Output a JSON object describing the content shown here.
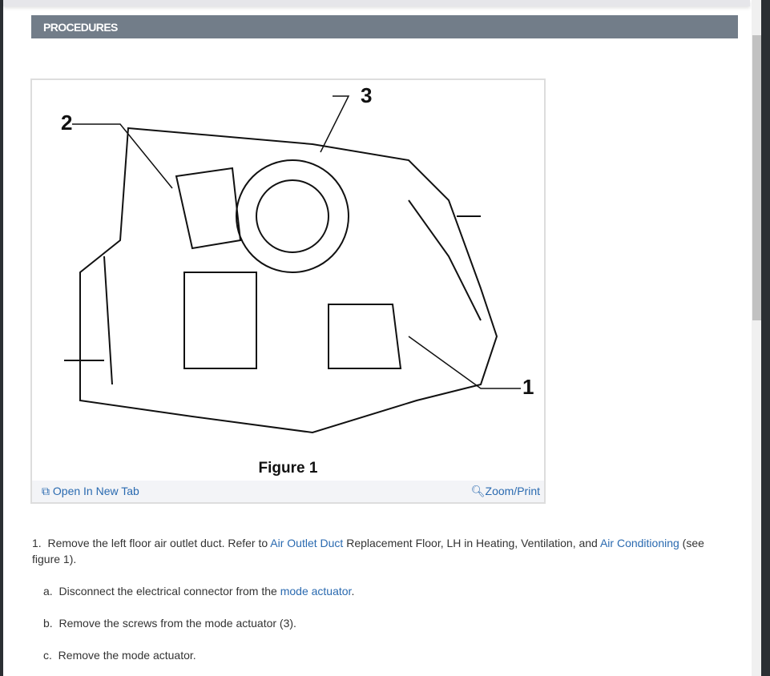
{
  "header": {
    "title": "PROCEDURES"
  },
  "figure": {
    "caption": "Figure 1",
    "callouts": [
      "1",
      "2",
      "3"
    ],
    "open_tab": "Open In New Tab",
    "zoom_print": "Zoom/Print"
  },
  "steps": {
    "s1": {
      "num": "1.",
      "t1": "Remove the left floor air outlet duct. Refer to ",
      "l1": "Air Outlet Duct",
      "t2": " Replacement Floor, LH in Heating, Ventilation, and ",
      "l2": "Air Conditioning",
      "t3": " (see figure 1)."
    },
    "a": {
      "num": "a.",
      "t1": "Disconnect the electrical connector from the ",
      "l1": "mode actuator",
      "t2": "."
    },
    "b": {
      "num": "b.",
      "t1": "Remove the screws from the mode actuator (3)."
    },
    "c": {
      "num": "c.",
      "t1": "Remove the mode actuator."
    }
  }
}
